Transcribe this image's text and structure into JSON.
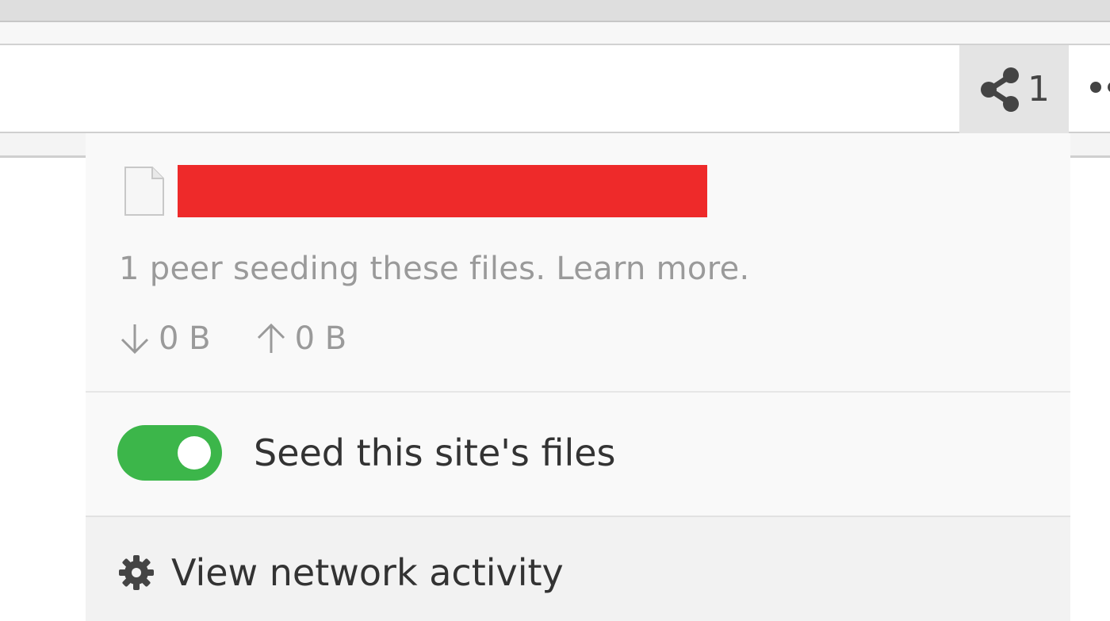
{
  "toolbar": {
    "peers_count": "1",
    "peers_icon": "share-icon",
    "more_icon": "more-dots-icon"
  },
  "panel": {
    "file_icon": "file-icon",
    "file_name": "",
    "redaction_color": "#ee2a2a",
    "seeding_text": "1 peer seeding these files. Learn more.",
    "download_value": "0 B",
    "upload_value": "0 B",
    "toggle_label": "Seed this site's files",
    "toggle_on": true,
    "toggle_color": "#3cb64a",
    "activity_label": "View network activity",
    "activity_icon": "gear-icon"
  }
}
